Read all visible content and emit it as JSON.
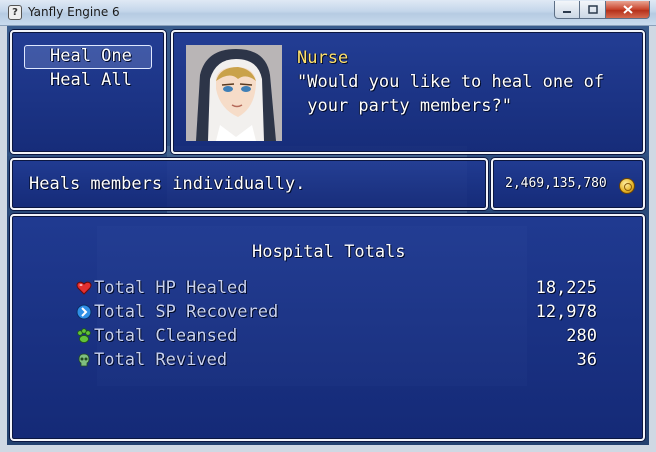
{
  "window": {
    "title": "Yanfly Engine 6",
    "icon_glyph": "?"
  },
  "commands": {
    "items": [
      {
        "label": "Heal One",
        "selected": true
      },
      {
        "label": "Heal All",
        "selected": false
      }
    ]
  },
  "message": {
    "speaker": "Nurse",
    "line1": "\"Would you like to heal one of",
    "line2": " your party members?\""
  },
  "help": {
    "text": "Heals members individually."
  },
  "gold": {
    "amount": "2,469,135,780",
    "icon": "gold-coin-icon"
  },
  "hospital": {
    "title": "Hospital Totals",
    "stats": [
      {
        "label": "Total HP Healed",
        "value": "18,225",
        "icon": "heart-icon"
      },
      {
        "label": "Total SP Recovered",
        "value": "12,978",
        "icon": "blue-orb-icon"
      },
      {
        "label": "Total Cleansed",
        "value": "280",
        "icon": "paw-icon"
      },
      {
        "label": "Total Revived",
        "value": "36",
        "icon": "skull-icon"
      }
    ]
  },
  "colors": {
    "speaker_name": "#ffe16b",
    "window_fill": "#1e3796",
    "window_border": "#f2f4fa"
  }
}
